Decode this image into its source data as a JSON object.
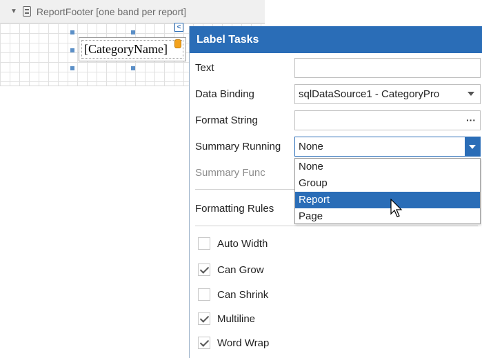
{
  "band": {
    "title": "ReportFooter [one band per report]",
    "label_text": "[CategoryName]"
  },
  "panel": {
    "title": "Label Tasks",
    "text_label": "Text",
    "text_value": "",
    "data_binding_label": "Data Binding",
    "data_binding_value": "sqlDataSource1 - CategoryPro",
    "format_string_label": "Format String",
    "format_string_value": "",
    "summary_running_label": "Summary Running",
    "summary_running_value": "None",
    "summary_func_label": "Summary Func",
    "formatting_rules_label": "Formatting Rules",
    "dropdown_options": [
      "None",
      "Group",
      "Report",
      "Page"
    ],
    "dropdown_selected": "Report",
    "checkboxes": [
      {
        "label": "Auto Width",
        "checked": false
      },
      {
        "label": "Can Grow",
        "checked": true
      },
      {
        "label": "Can Shrink",
        "checked": false
      },
      {
        "label": "Multiline",
        "checked": true
      },
      {
        "label": "Word Wrap",
        "checked": true
      }
    ]
  },
  "colors": {
    "accent": "#2a6db7",
    "selection": "#2a6db7"
  }
}
